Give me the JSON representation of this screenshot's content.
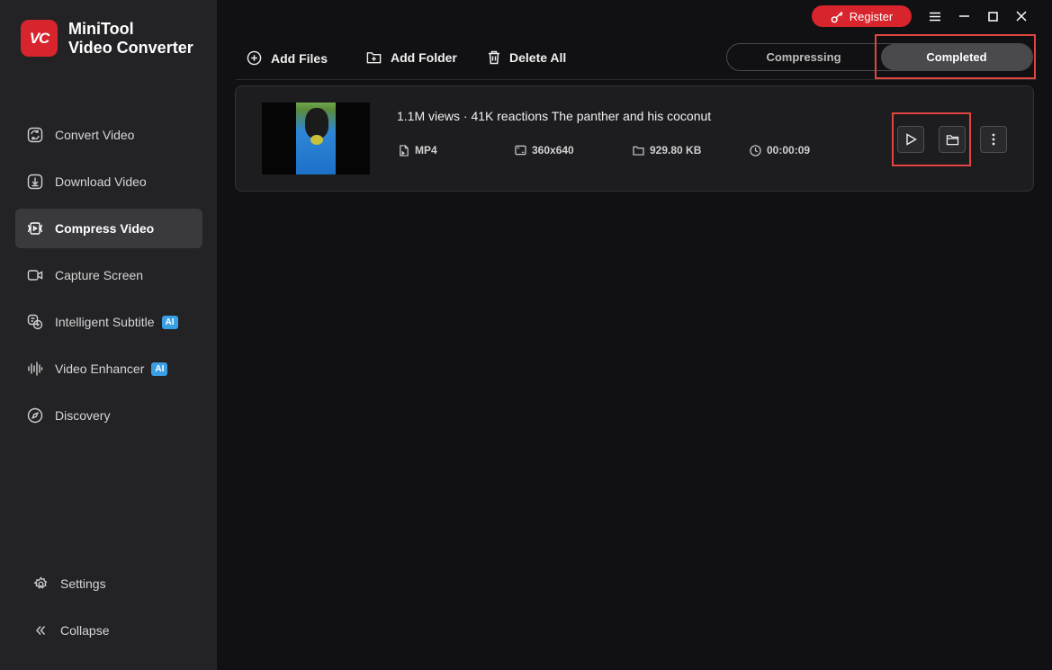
{
  "app": {
    "title_line1": "MiniTool",
    "title_line2": "Video Converter",
    "logo_text": "VC"
  },
  "titlebar": {
    "register_label": "Register"
  },
  "sidebar": {
    "items": [
      {
        "label": "Convert Video",
        "icon": "convert-icon"
      },
      {
        "label": "Download Video",
        "icon": "download-icon"
      },
      {
        "label": "Compress Video",
        "icon": "compress-icon",
        "active": true
      },
      {
        "label": "Capture Screen",
        "icon": "camera-icon"
      },
      {
        "label": "Intelligent Subtitle",
        "icon": "subtitle-icon",
        "badge": "AI"
      },
      {
        "label": "Video Enhancer",
        "icon": "waveform-icon",
        "badge": "AI"
      },
      {
        "label": "Discovery",
        "icon": "compass-icon"
      }
    ],
    "bottom": {
      "settings_label": "Settings",
      "collapse_label": "Collapse"
    }
  },
  "toolbar": {
    "add_files": "Add Files",
    "add_folder": "Add Folder",
    "delete_all": "Delete All"
  },
  "tabs": {
    "compressing": "Compressing",
    "completed": "Completed",
    "active": "completed"
  },
  "file": {
    "title": "1.1M views · 41K reactions  The panther and his coconut",
    "format": "MP4",
    "resolution": "360x640",
    "size": "929.80 KB",
    "duration": "00:00:09"
  },
  "colors": {
    "accent": "#d8242c",
    "highlight": "#e0453f",
    "ai_badge": "#3aa0e6"
  }
}
